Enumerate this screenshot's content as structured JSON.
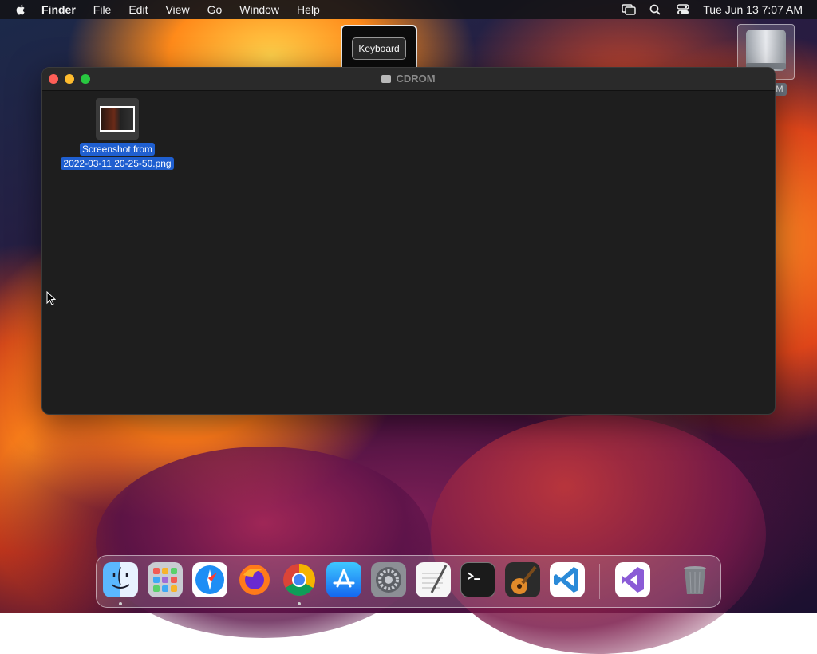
{
  "menubar": {
    "app_name": "Finder",
    "items": [
      "File",
      "Edit",
      "View",
      "Go",
      "Window",
      "Help"
    ],
    "clock": "Tue Jun 13  7:07 AM",
    "icons": [
      "screen-mirroring-icon",
      "spotlight-search-icon",
      "control-center-icon"
    ]
  },
  "popup": {
    "button_label": "Keyboard"
  },
  "desktop": {
    "disk_label_fragment": "M"
  },
  "window": {
    "title": "CDROM",
    "file": {
      "name_line1": "Screenshot from",
      "name_line2": "2022-03-11 20-25-50.png"
    }
  },
  "dock": {
    "apps": [
      "finder-icon",
      "launchpad-icon",
      "safari-icon",
      "firefox-icon",
      "chrome-icon",
      "app-store-icon",
      "system-settings-icon",
      "textedit-icon",
      "terminal-icon",
      "garageband-icon",
      "vscode-icon",
      "visual-studio-icon",
      "trash-icon"
    ],
    "colors": {
      "finder": "#2f8cf0",
      "safari": "#1e8ef5",
      "vscode": "#2a8ad8",
      "vs": "#8a5bd6"
    }
  }
}
